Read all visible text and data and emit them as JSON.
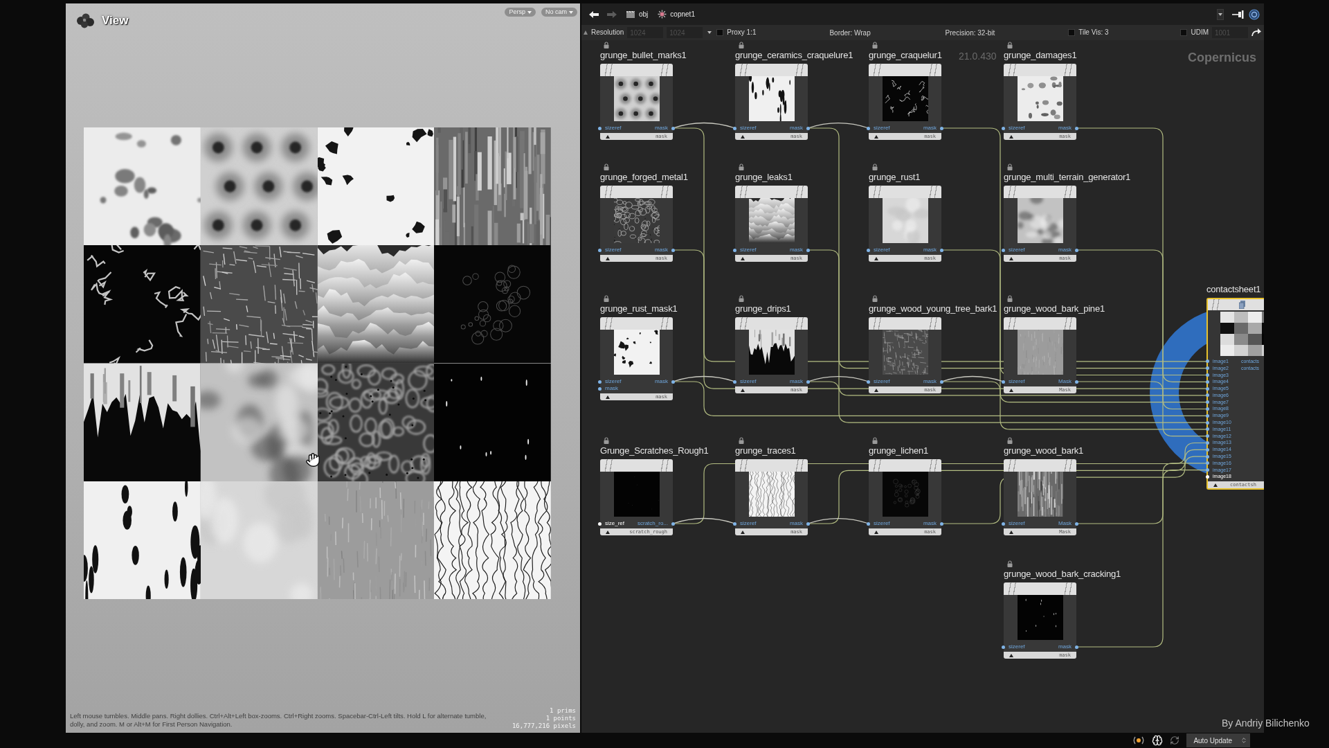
{
  "viewport": {
    "title": "View",
    "camera_menus": [
      {
        "label": "Persp"
      },
      {
        "label": "No cam"
      }
    ],
    "help_text": "Left mouse tumbles. Middle pans. Right dollies. Ctrl+Alt+Left box-zooms. Ctrl+Right zooms. Spacebar-Ctrl-Left tilts. Hold L for alternate tumble, dolly, and zoom. M or Alt+M for First Person Navigation.",
    "stats": [
      "1 prims",
      "1 points",
      "16,777,216 pixels"
    ]
  },
  "network": {
    "navigation": [
      {
        "kind": "back",
        "disabled": false
      },
      {
        "kind": "forward",
        "disabled": true
      }
    ],
    "path": [
      {
        "kind": "obj",
        "label": "obj"
      },
      {
        "kind": "copnet",
        "label": "copnet1"
      }
    ],
    "options": {
      "resolution": {
        "label": "Resolution",
        "fields": [
          {
            "value": "1024",
            "disabled": true
          },
          {
            "value": "1024",
            "disabled": true
          }
        ]
      },
      "proxy": {
        "label": "Proxy 1:1",
        "checked": false
      },
      "menus": [
        {
          "label": "Border: Wrap"
        },
        {
          "label": "Precision: 32-bit"
        }
      ],
      "tile_vis": {
        "label": "Tile Vis: 3",
        "checked": false
      },
      "udim": {
        "label": "UDIM",
        "checked": false,
        "field": {
          "value": "1001",
          "disabled": true
        }
      }
    },
    "context_label": "Copernicus",
    "version_label": "21.0.430",
    "nodes": [
      {
        "name": "grunge_bullet_marks1",
        "inputs": [
          {
            "label": "sizeref",
            "connected": false,
            "selected": false
          }
        ],
        "output": "mask",
        "footer": "mask"
      },
      {
        "name": "grunge_ceramics_craquelure1",
        "inputs": [
          {
            "label": "sizeref",
            "connected": true,
            "selected": false
          }
        ],
        "output": "mask",
        "footer": "mask"
      },
      {
        "name": "grunge_craquelur1",
        "inputs": [
          {
            "label": "sizeref",
            "connected": true,
            "selected": false
          }
        ],
        "output": "mask",
        "footer": "mask"
      },
      {
        "name": "grunge_damages1",
        "inputs": [
          {
            "label": "sizeref",
            "connected": false,
            "selected": false
          }
        ],
        "output": "mask",
        "footer": "mask"
      },
      {
        "name": "grunge_forged_metal1",
        "inputs": [
          {
            "label": "sizeref",
            "connected": false,
            "selected": false
          }
        ],
        "output": "mask",
        "footer": "mask"
      },
      {
        "name": "grunge_leaks1",
        "inputs": [
          {
            "label": "sizeref",
            "connected": false,
            "selected": false
          }
        ],
        "output": "mask",
        "footer": "mask"
      },
      {
        "name": "grunge_rust1",
        "inputs": [
          {
            "label": "sizeref",
            "connected": false,
            "selected": false
          }
        ],
        "output": "mask",
        "footer": "mask"
      },
      {
        "name": "grunge_multi_terrain_generator1",
        "inputs": [
          {
            "label": "sizeref",
            "connected": false,
            "selected": false
          }
        ],
        "output": "mask",
        "footer": "mask"
      },
      {
        "name": "grunge_rust_mask1",
        "inputs": [
          {
            "label": "sizeref",
            "connected": false,
            "selected": false
          },
          {
            "label": "mask",
            "connected": false,
            "selected": false
          }
        ],
        "output": "mask",
        "footer": "mask"
      },
      {
        "name": "grunge_drips1",
        "inputs": [
          {
            "label": "sizeref",
            "connected": true,
            "selected": false
          }
        ],
        "output": "mask",
        "footer": "mask"
      },
      {
        "name": "grunge_wood_young_tree_bark1",
        "inputs": [
          {
            "label": "sizeref",
            "connected": true,
            "selected": false
          }
        ],
        "output": "mask",
        "footer": "mask"
      },
      {
        "name": "grunge_wood_bark_pine1",
        "inputs": [
          {
            "label": "sizeref",
            "connected": true,
            "selected": false
          }
        ],
        "output": "Mask",
        "footer": "Mask"
      },
      {
        "name": "Grunge_Scratches_Rough1",
        "inputs": [
          {
            "label": "size_ref",
            "connected": false,
            "selected": true
          }
        ],
        "output": "scratch_ro...",
        "footer": "scratch_rough"
      },
      {
        "name": "grunge_traces1",
        "inputs": [
          {
            "label": "sizeref",
            "connected": true,
            "selected": false
          }
        ],
        "output": "mask",
        "footer": "mask"
      },
      {
        "name": "grunge_lichen1",
        "inputs": [
          {
            "label": "sizeref",
            "connected": true,
            "selected": false
          }
        ],
        "output": "mask",
        "footer": "mask"
      },
      {
        "name": "grunge_wood_bark1",
        "inputs": [
          {
            "label": "sizeref",
            "connected": false,
            "selected": false
          }
        ],
        "output": "Mask",
        "footer": "Mask"
      },
      {
        "name": "grunge_wood_bark_cracking1",
        "inputs": [
          {
            "label": "sizeref",
            "connected": false,
            "selected": false
          }
        ],
        "output": "mask",
        "footer": "mask"
      }
    ],
    "output_node": {
      "name": "contactsheet1",
      "selected": true,
      "inputs": [
        {
          "label": "image1",
          "selected": false
        },
        {
          "label": "image2",
          "selected": false
        },
        {
          "label": "image3",
          "selected": false
        },
        {
          "label": "image4",
          "selected": false
        },
        {
          "label": "image5",
          "selected": false
        },
        {
          "label": "image6",
          "selected": false
        },
        {
          "label": "image7",
          "selected": false
        },
        {
          "label": "image8",
          "selected": false
        },
        {
          "label": "image9",
          "selected": false
        },
        {
          "label": "image10",
          "selected": false
        },
        {
          "label": "image11",
          "selected": false
        },
        {
          "label": "image12",
          "selected": false
        },
        {
          "label": "image13",
          "selected": false
        },
        {
          "label": "image14",
          "selected": false
        },
        {
          "label": "image15",
          "selected": false
        },
        {
          "label": "image16",
          "selected": false
        },
        {
          "label": "image17",
          "selected": false
        },
        {
          "label": "image18",
          "selected": true
        }
      ],
      "outputs": [
        "contacts",
        "contacts"
      ],
      "footer": "contactsh"
    }
  },
  "status_bar": {
    "update_mode": "Auto Update"
  },
  "caption": "By Andriy Bilichenko"
}
